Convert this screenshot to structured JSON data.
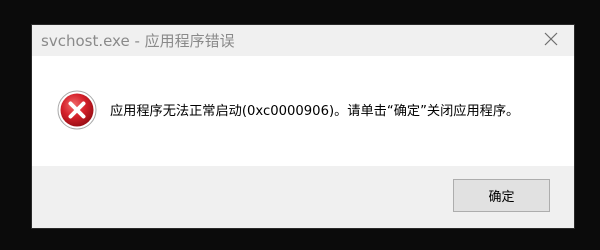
{
  "dialog": {
    "title": "svchost.exe - 应用程序错误",
    "message": "应用程序无法正常启动(0xc0000906)。请单击“确定”关闭应用程序。",
    "ok_label": "确定",
    "icon": "error-icon",
    "close_icon": "close-icon"
  },
  "colors": {
    "error_red": "#c9161d",
    "dialog_bg": "#f0f0f0",
    "content_bg": "#ffffff",
    "title_text": "#8a8a8a",
    "backdrop": "#0b0b0b"
  }
}
